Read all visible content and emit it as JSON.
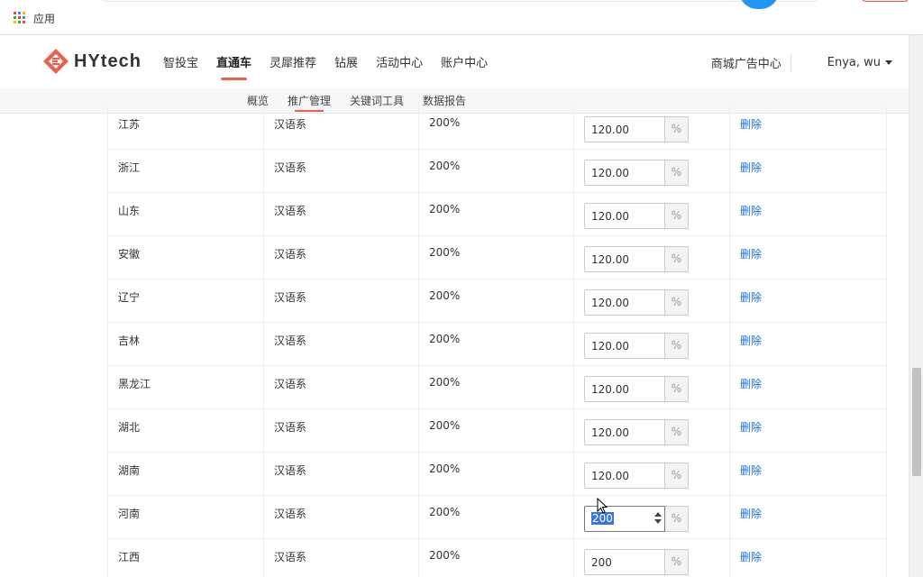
{
  "browser": {
    "apps_label": "应用",
    "apps_icon": "apps-grid-icon"
  },
  "header": {
    "brand": "HYtech",
    "nav": [
      {
        "label": "智投宝",
        "active": false
      },
      {
        "label": "直通车",
        "active": true
      },
      {
        "label": "灵犀推荐",
        "active": false
      },
      {
        "label": "钻展",
        "active": false
      },
      {
        "label": "活动中心",
        "active": false
      },
      {
        "label": "账户中心",
        "active": false
      }
    ],
    "ad_center": "商城广告中心",
    "user": "Enya, wu"
  },
  "subnav": [
    {
      "label": "概览",
      "active": false
    },
    {
      "label": "推广管理",
      "active": true
    },
    {
      "label": "关键词工具",
      "active": false
    },
    {
      "label": "数据报告",
      "active": false
    }
  ],
  "table": {
    "unit": "%",
    "delete_label": "删除",
    "rows": [
      {
        "region": "江苏",
        "group": "汉语系",
        "max": "200%",
        "value": "120.00"
      },
      {
        "region": "浙江",
        "group": "汉语系",
        "max": "200%",
        "value": "120.00"
      },
      {
        "region": "山东",
        "group": "汉语系",
        "max": "200%",
        "value": "120.00"
      },
      {
        "region": "安徽",
        "group": "汉语系",
        "max": "200%",
        "value": "120.00"
      },
      {
        "region": "辽宁",
        "group": "汉语系",
        "max": "200%",
        "value": "120.00"
      },
      {
        "region": "吉林",
        "group": "汉语系",
        "max": "200%",
        "value": "120.00"
      },
      {
        "region": "黑龙江",
        "group": "汉语系",
        "max": "200%",
        "value": "120.00"
      },
      {
        "region": "湖北",
        "group": "汉语系",
        "max": "200%",
        "value": "120.00"
      },
      {
        "region": "湖南",
        "group": "汉语系",
        "max": "200%",
        "value": "120.00"
      },
      {
        "region": "河南",
        "group": "汉语系",
        "max": "200%",
        "value": "200",
        "focused": true
      },
      {
        "region": "江西",
        "group": "汉语系",
        "max": "200%",
        "value": "200"
      }
    ]
  },
  "colors": {
    "accent": "#e8614f",
    "link": "#1e6fd9",
    "selection": "#3a78d6"
  }
}
